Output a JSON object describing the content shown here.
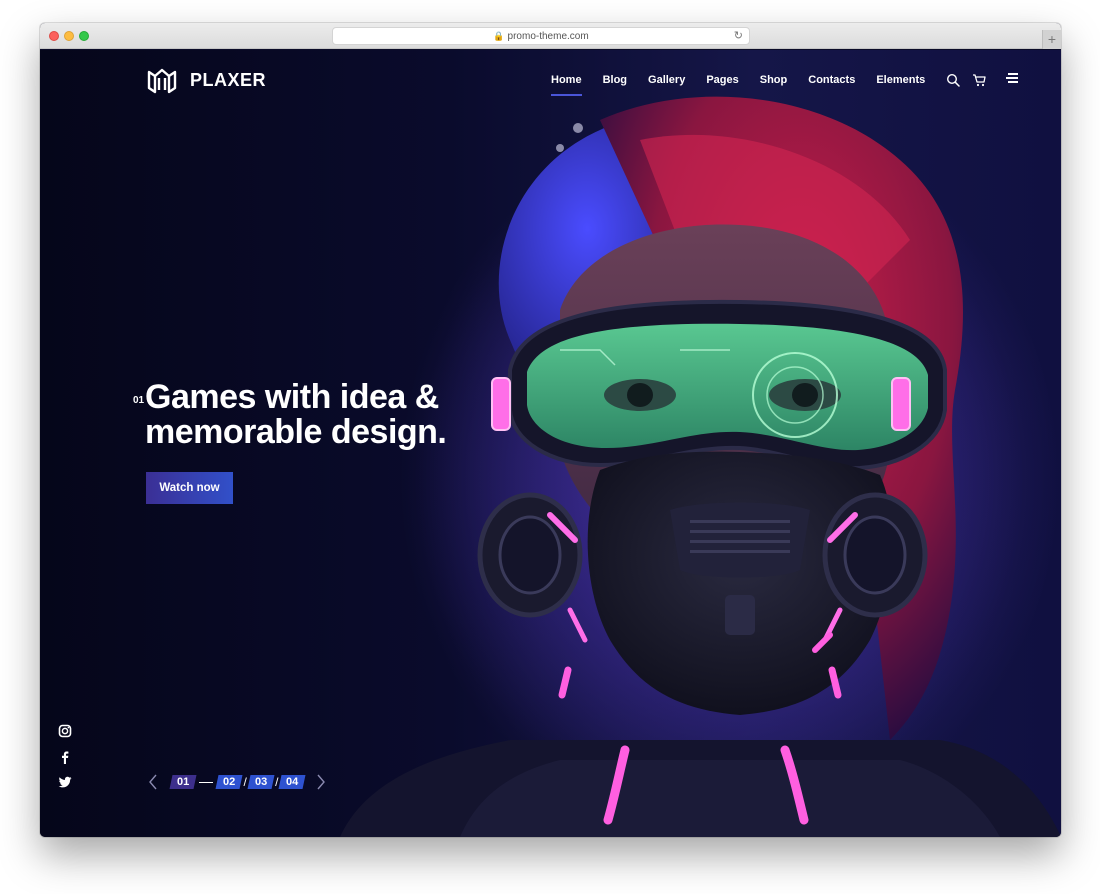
{
  "browser": {
    "url": "promo-theme.com",
    "new_tab_glyph": "+"
  },
  "header": {
    "logo_text": "PLAXER",
    "nav": [
      {
        "label": "Home",
        "active": true
      },
      {
        "label": "Blog"
      },
      {
        "label": "Gallery"
      },
      {
        "label": "Pages"
      },
      {
        "label": "Shop"
      },
      {
        "label": "Contacts"
      },
      {
        "label": "Elements"
      }
    ],
    "icons": [
      "search-icon",
      "cart-icon",
      "menu-icon"
    ]
  },
  "hero": {
    "slide_index": "01",
    "title_line1": "Games with idea &",
    "title_line2": "memorable design.",
    "cta_label": "Watch now"
  },
  "social": [
    "instagram-icon",
    "facebook-icon",
    "twitter-icon"
  ],
  "pager": {
    "items": [
      "01",
      "02",
      "03",
      "04"
    ],
    "active": "01"
  },
  "colors": {
    "accent": "#3150c9",
    "active_pager": "#3d2f8c",
    "background": "#0b0c28",
    "neon_pink": "#ff5fe0",
    "visor_green": "#58e08a"
  }
}
